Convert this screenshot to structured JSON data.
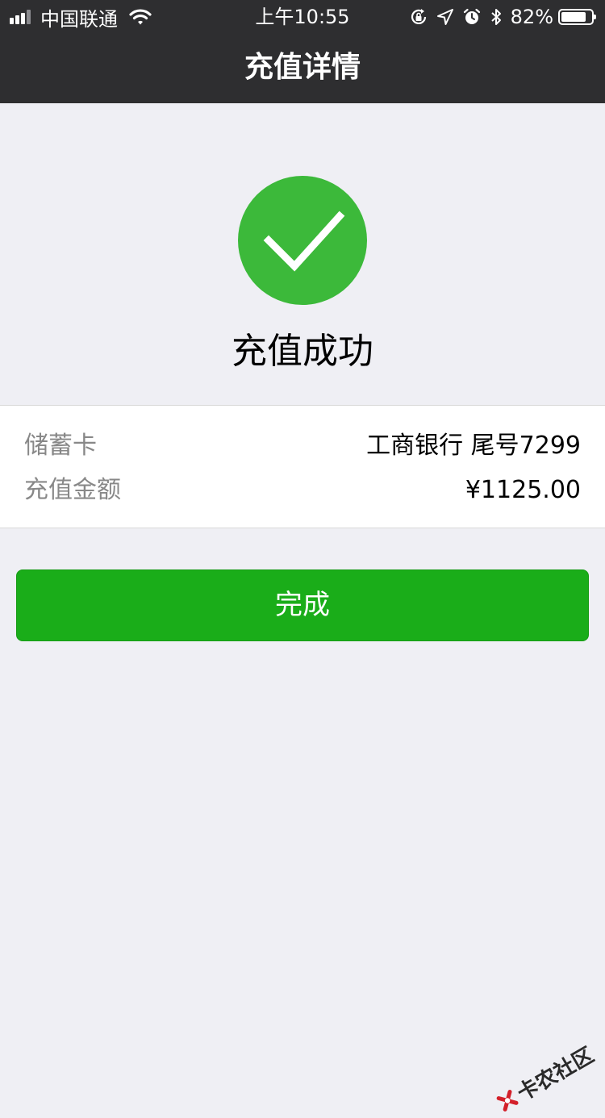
{
  "status_bar": {
    "carrier": "中国联通",
    "time": "上午10:55",
    "battery_percent": "82%",
    "battery_level": 0.82,
    "icons": [
      "signal-icon",
      "wifi-icon",
      "orientation-lock-icon",
      "location-icon",
      "alarm-icon",
      "bluetooth-icon",
      "battery-icon"
    ]
  },
  "nav": {
    "title": "充值详情"
  },
  "result": {
    "icon": "checkmark-icon",
    "title": "充值成功",
    "icon_color": "#3cb93a"
  },
  "details": {
    "rows": [
      {
        "label": "储蓄卡",
        "value": "工商银行 尾号7299"
      },
      {
        "label": "充值金额",
        "value": "¥1125.00"
      }
    ]
  },
  "actions": {
    "done_label": "完成",
    "done_color": "#1aad19"
  },
  "watermark": {
    "text": "卡农社区"
  }
}
